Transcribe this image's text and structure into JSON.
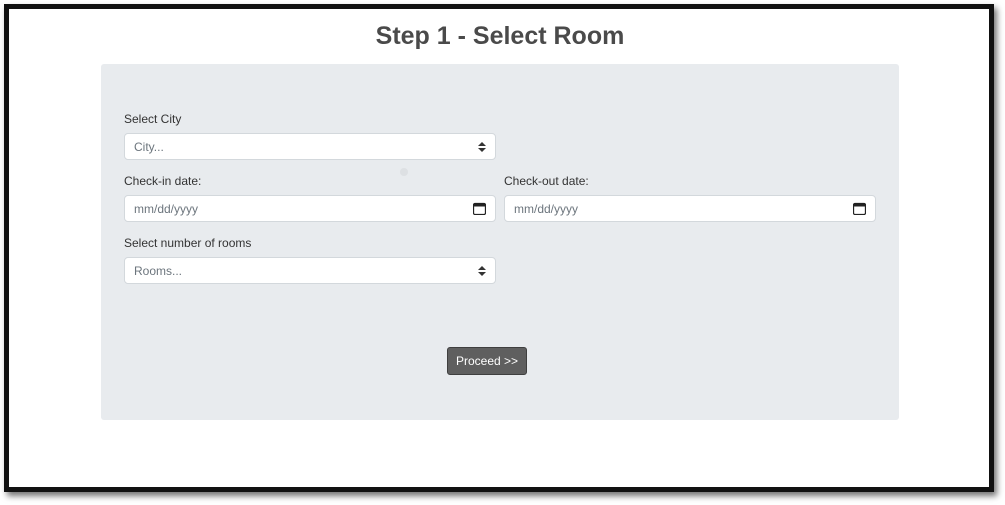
{
  "page": {
    "title": "Step 1 - Select Room"
  },
  "form": {
    "city": {
      "label": "Select City",
      "value": "City..."
    },
    "checkin": {
      "label": "Check-in date:",
      "value": "mm/dd/yyyy"
    },
    "checkout": {
      "label": "Check-out date:",
      "value": "mm/dd/yyyy"
    },
    "rooms": {
      "label": "Select number of rooms",
      "value": "Rooms..."
    },
    "proceed_label": "Proceed >>"
  },
  "icons": {
    "select_caret": "caret-up-down-icon",
    "date_picker": "calendar-icon"
  },
  "colors": {
    "panel_bg": "#e8ebee",
    "button_bg": "#5f5f5f",
    "title_text": "#4a4a4a"
  }
}
